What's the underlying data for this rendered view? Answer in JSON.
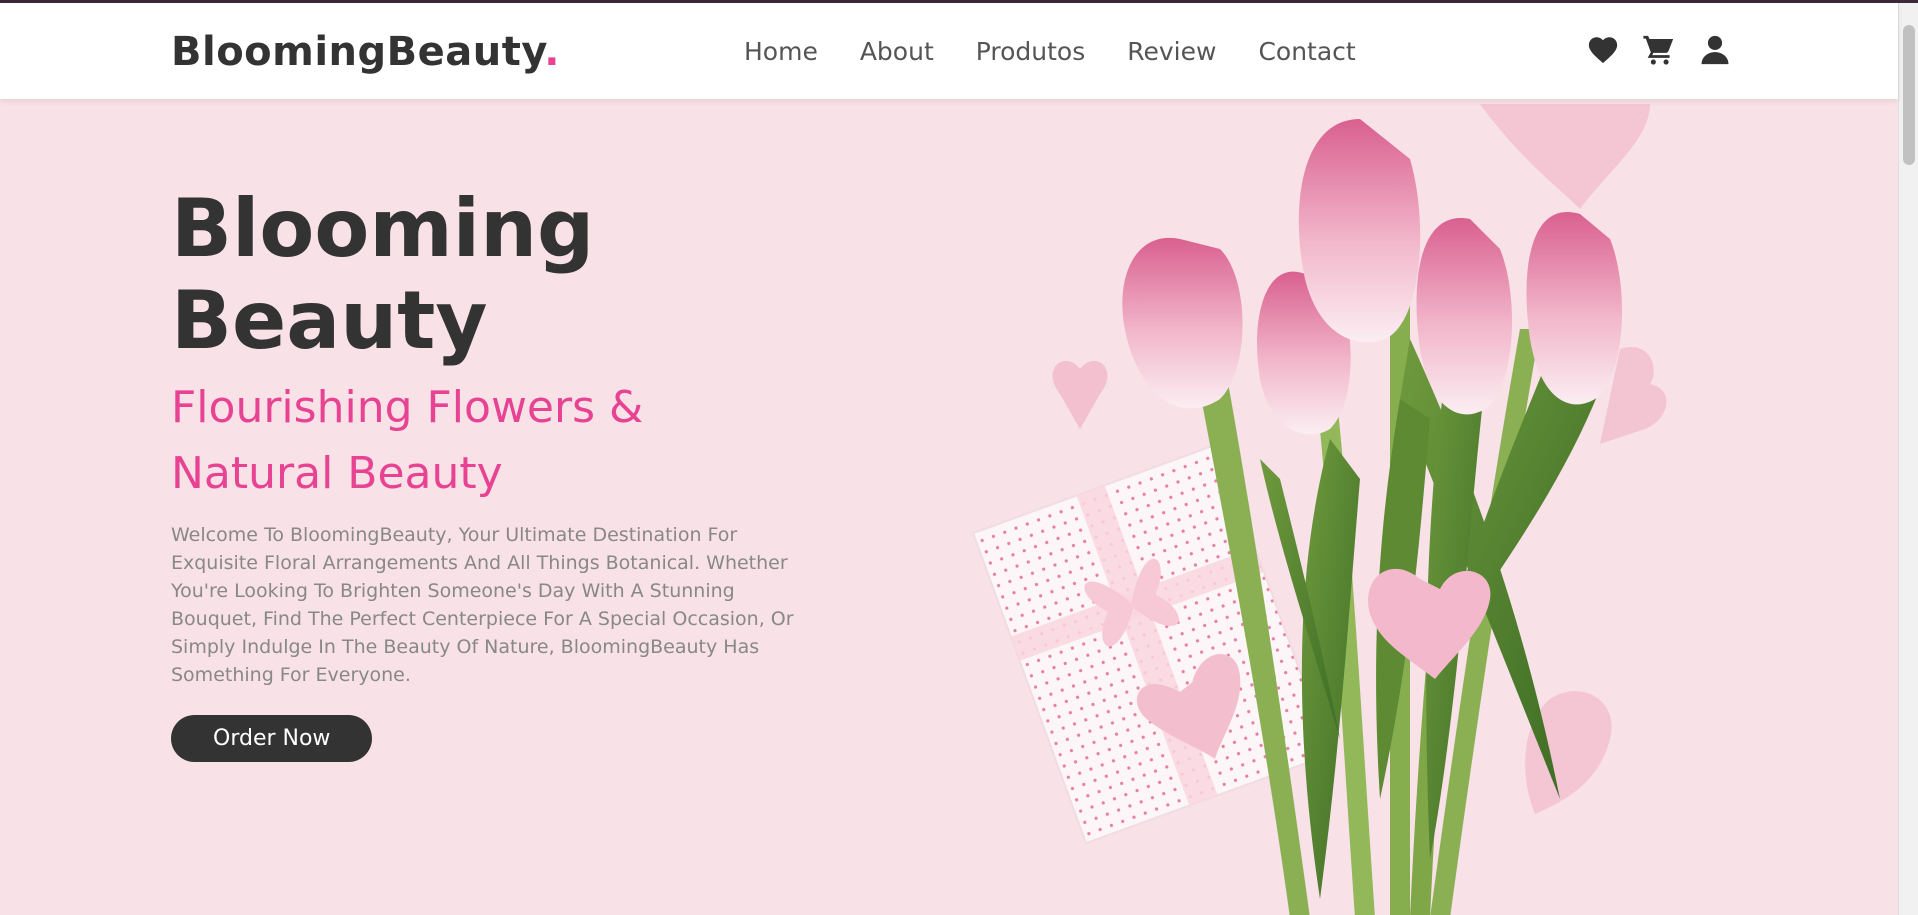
{
  "brand": {
    "name": "BloomingBeauty",
    "dot": "."
  },
  "nav": {
    "links": [
      "Home",
      "About",
      "Produtos",
      "Review",
      "Contact"
    ]
  },
  "icons": [
    "heart-icon",
    "cart-icon",
    "user-icon"
  ],
  "hero": {
    "title": "Blooming Beauty",
    "subtitle": "Flourishing Flowers & Natural Beauty",
    "description": "Welcome To BloomingBeauty, Your Ultimate Destination For Exquisite Floral Arrangements And All Things Botanical. Whether You're Looking To Brighten Someone's Day With A Stunning Bouquet, Find The Perfect Centerpiece For A Special Occasion, Or Simply Indulge In The Beauty Of Nature, BloomingBeauty Has Something For Everyone.",
    "cta": "Order Now"
  },
  "colors": {
    "accent": "#e84393",
    "dark": "#333333",
    "background": "#f8e1e7"
  }
}
